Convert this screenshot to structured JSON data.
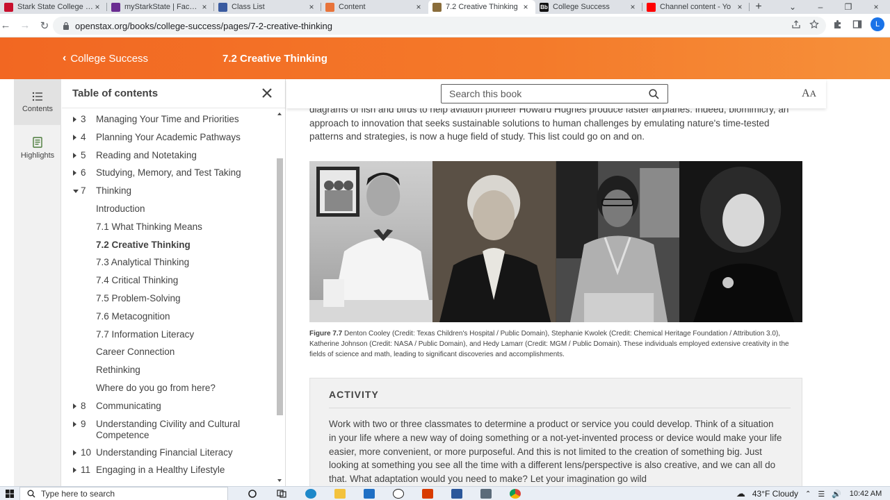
{
  "browser": {
    "tabs": [
      {
        "title": "Stark State College | c",
        "fav_color": "#c8102e",
        "active": false
      },
      {
        "title": "myStarkState | Faculty",
        "fav_color": "#6a2c91",
        "active": false
      },
      {
        "title": "Class List",
        "fav_color": "#3a5ba0",
        "active": false
      },
      {
        "title": "Content",
        "fav_color": "#e8743b",
        "active": false
      },
      {
        "title": "7.2 Creative Thinking",
        "fav_color": "#8a6d3b",
        "active": true
      },
      {
        "title": "College Success",
        "fav_color": "#111111",
        "fav_text": "Bb",
        "active": false
      },
      {
        "title": "Channel content - Yo",
        "fav_color": "#ff0000",
        "active": false
      }
    ],
    "new_tab": "+",
    "url": "openstax.org/books/college-success/pages/7-2-creative-thinking",
    "avatar_letter": "L"
  },
  "header": {
    "back_label": "College Success",
    "page_title": "7.2 Creative Thinking",
    "accent_color": "#f26722"
  },
  "rail": {
    "contents_label": "Contents",
    "highlights_label": "Highlights"
  },
  "toc": {
    "title": "Table of contents",
    "items": [
      {
        "num": "3",
        "label": "Managing Your Time and Priorities",
        "caret": "right"
      },
      {
        "num": "4",
        "label": "Planning Your Academic Pathways",
        "caret": "right"
      },
      {
        "num": "5",
        "label": "Reading and Notetaking",
        "caret": "right"
      },
      {
        "num": "6",
        "label": "Studying, Memory, and Test Taking",
        "caret": "right"
      },
      {
        "num": "7",
        "label": "Thinking",
        "caret": "down"
      },
      {
        "num": "",
        "label": "Introduction",
        "caret": "none"
      },
      {
        "num": "",
        "label": "7.1  What Thinking Means",
        "caret": "none"
      },
      {
        "num": "",
        "label": "7.2  Creative Thinking",
        "caret": "none",
        "bold": true
      },
      {
        "num": "",
        "label": "7.3  Analytical Thinking",
        "caret": "none"
      },
      {
        "num": "",
        "label": "7.4  Critical Thinking",
        "caret": "none"
      },
      {
        "num": "",
        "label": "7.5  Problem-Solving",
        "caret": "none"
      },
      {
        "num": "",
        "label": "7.6  Metacognition",
        "caret": "none"
      },
      {
        "num": "",
        "label": "7.7  Information Literacy",
        "caret": "none"
      },
      {
        "num": "",
        "label": "Career Connection",
        "caret": "none"
      },
      {
        "num": "",
        "label": "Rethinking",
        "caret": "none"
      },
      {
        "num": "",
        "label": "Where do you go from here?",
        "caret": "none"
      },
      {
        "num": "8",
        "label": "Communicating",
        "caret": "right"
      },
      {
        "num": "9",
        "label": "Understanding Civility and Cultural Competence",
        "caret": "right"
      },
      {
        "num": "10",
        "label": "Understanding Financial Literacy",
        "caret": "right"
      },
      {
        "num": "11",
        "label": "Engaging in a Healthy Lifestyle",
        "caret": "right"
      }
    ]
  },
  "search": {
    "placeholder": "Search this book"
  },
  "content": {
    "paragraph": "diagrams of fish and birds to help aviation pioneer Howard Hughes produce faster airplanes. Indeed, biomimicry, an approach to innovation that seeks sustainable solutions to human challenges by emulating nature's time-tested patterns and strategies, is now a huge field of study. This list could go on and on.",
    "figure_label": "Figure 7.7",
    "figure_caption": " Denton Cooley (Credit: Texas Children's Hospital / Public Domain), Stephanie Kwolek (Credit: Chemical Heritage Foundation / Attribution 3.0), Katherine Johnson (Credit: NASA / Public Domain), and Hedy Lamarr (Credit: MGM / Public Domain). These individuals employed extensive creativity in the fields of science and math, leading to significant discoveries and accomplishments.",
    "activity_title": "ACTIVITY",
    "activity_body": "Work with two or three classmates to determine a product or service you could develop. Think of a situation in your life where a new way of doing something or a not-yet-invented process or device would make your life easier, more convenient, or more purposeful. And this is not limited to the creation of something big. Just looking at something you see all the time with a different lens/perspective is also creative, and we can all do that. What adaptation would you need to make? Let your imagination go wild"
  },
  "taskbar": {
    "search_placeholder": "Type here to search",
    "weather": "43°F  Cloudy",
    "time": "10:42 AM"
  }
}
